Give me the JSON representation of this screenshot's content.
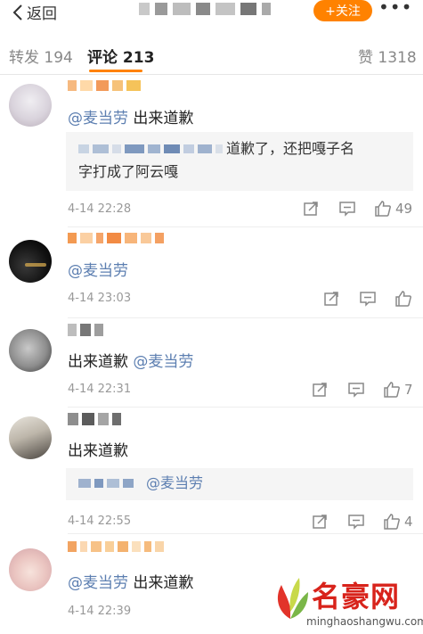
{
  "header": {
    "back_label": "返回",
    "follow_label": "+关注",
    "more_label": "•••"
  },
  "tabs": {
    "reposts_label": "转发 194",
    "comments_label": "评论 213",
    "likes_label": "赞 1318"
  },
  "comments": [
    {
      "text_at": "@麦当劳",
      "text_rest": " 出来道歉",
      "reply_line1": "道歉了，还把嘎子名",
      "reply_line2": "字打成了阿云嘎",
      "time": "4-14 22:28",
      "likes": "49"
    },
    {
      "text_at": "@麦当劳",
      "text_rest": "",
      "time": "4-14 23:03",
      "likes": ""
    },
    {
      "text_pre": "出来道歉 ",
      "text_at": "@麦当劳",
      "time": "4-14 22:31",
      "likes": "7"
    },
    {
      "text_rest": "出来道歉",
      "reply_at": "@麦当劳",
      "time": "4-14 22:55",
      "likes": "4"
    },
    {
      "text_at": "@麦当劳",
      "text_rest": " 出来道歉",
      "time": "4-14 22:39"
    }
  ],
  "watermark": {
    "title": "名豪网",
    "url": "minghaoshangwu.com"
  },
  "colors": {
    "accent": "#ff8200",
    "link": "#5d7fb1",
    "watermark": "#d8231b"
  }
}
